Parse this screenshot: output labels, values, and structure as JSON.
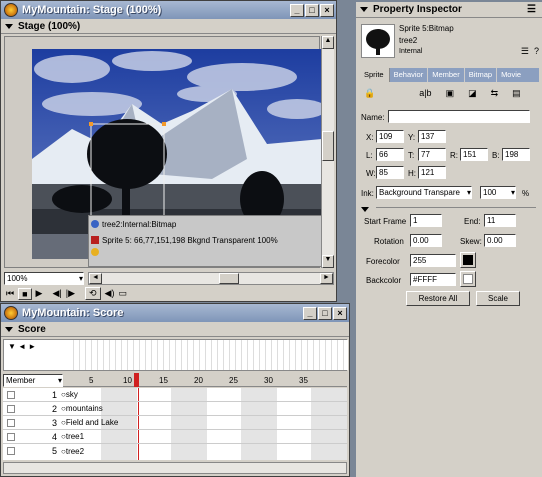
{
  "stage_window": {
    "title": "MyMountain: Stage (100%)",
    "panel_label": "Stage (100%)",
    "zoom": "100%"
  },
  "sprite_overlay": {
    "line1": "tree2:Internal:Bitmap",
    "line2": "Sprite 5: 66,77,151,198 Bkgnd Transparent 100%"
  },
  "score_window": {
    "title": "MyMountain: Score",
    "panel_label": "Score",
    "member_dropdown": "Member",
    "frame_numbers": [
      "5",
      "10",
      "15",
      "20",
      "25",
      "30",
      "35"
    ],
    "channels": [
      {
        "num": "1",
        "name": "sky"
      },
      {
        "num": "2",
        "name": "mountains"
      },
      {
        "num": "3",
        "name": "Field and Lake"
      },
      {
        "num": "4",
        "name": "tree1"
      },
      {
        "num": "5",
        "name": "tree2"
      }
    ]
  },
  "inspector": {
    "title": "Property Inspector",
    "sprite_type": "Sprite 5:Bitmap",
    "member_name": "tree2",
    "cast": "Internal",
    "tabs": [
      "Sprite",
      "Behavior",
      "Member",
      "Bitmap",
      "Movie"
    ],
    "name_label": "Name:",
    "x_label": "X:",
    "x": "109",
    "y_label": "Y:",
    "y": "137",
    "l_label": "L:",
    "l": "66",
    "t_label": "T:",
    "t": "77",
    "r_label": "R:",
    "r": "151",
    "b_label": "B:",
    "b": "198",
    "w_label": "W:",
    "w": "85",
    "h_label": "H:",
    "h": "121",
    "ink_label": "Ink:",
    "ink": "Background Transpare",
    "blend": "100",
    "percent": "%",
    "start_label": "Start Frame",
    "start": "1",
    "end_label": "End:",
    "end": "11",
    "rotation_label": "Rotation",
    "rotation": "0.00",
    "skew_label": "Skew:",
    "skew": "0.00",
    "fore_label": "Forecolor",
    "fore": "255",
    "back_label": "Backcolor",
    "back": "#FFFF",
    "restore_label": "Restore All",
    "scale_label": "Scale"
  },
  "colors": {
    "titlebar": "#8b9fc0",
    "panel": "#d4d0c8",
    "playhead": "#d02020",
    "sky": "#2c4aa8"
  }
}
